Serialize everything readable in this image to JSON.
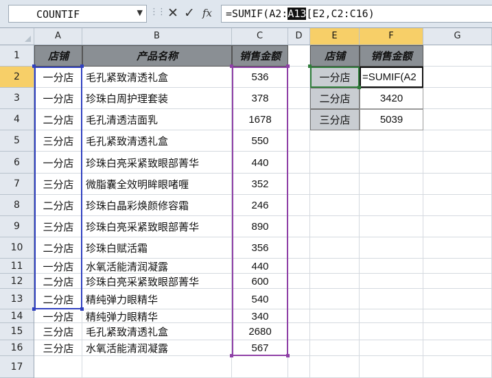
{
  "formula_bar": {
    "name_box": "COUNTIF",
    "formula_pre": "=SUMIF(A2:",
    "formula_hl": "A13",
    "formula_post": "[E2,C2:C16)",
    "fx_label": "fx"
  },
  "columns": [
    "A",
    "B",
    "C",
    "D",
    "E",
    "F",
    "G"
  ],
  "rows": [
    "1",
    "2",
    "3",
    "4",
    "5",
    "6",
    "7",
    "8",
    "9",
    "10",
    "11",
    "12",
    "13",
    "14",
    "15",
    "16",
    "17"
  ],
  "table": {
    "headers": [
      "店铺",
      "产品名称",
      "销售金额"
    ],
    "rows": [
      [
        "一分店",
        "毛孔紧致清透礼盒",
        "536"
      ],
      [
        "一分店",
        "珍珠白周护理套装",
        "378"
      ],
      [
        "二分店",
        "毛孔清透洁面乳",
        "1678"
      ],
      [
        "三分店",
        "毛孔紧致清透礼盒",
        "550"
      ],
      [
        "一分店",
        "珍珠白亮采紧致眼部菁华",
        "440"
      ],
      [
        "三分店",
        "微脂囊全效明眸眼啫喱",
        "352"
      ],
      [
        "二分店",
        "珍珠白晶彩焕颜修容霜",
        "246"
      ],
      [
        "三分店",
        "珍珠白亮采紧致眼部菁华",
        "890"
      ],
      [
        "二分店",
        "珍珠白赋活霜",
        "356"
      ],
      [
        "一分店",
        "水氧活能清润凝露",
        "440"
      ],
      [
        "二分店",
        "珍珠白亮采紧致眼部菁华",
        "600"
      ],
      [
        "二分店",
        "精纯弹力眼精华",
        "540"
      ],
      [
        "一分店",
        "精纯弹力眼精华",
        "340"
      ],
      [
        "三分店",
        "毛孔紧致清透礼盒",
        "2680"
      ],
      [
        "三分店",
        "水氧活能清润凝露",
        "567"
      ]
    ]
  },
  "summary": {
    "headers": [
      "店铺",
      "销售金额"
    ],
    "rows": [
      [
        "一分店",
        "=SUMIF(A2"
      ],
      [
        "二分店",
        "3420"
      ],
      [
        "三分店",
        "5039"
      ]
    ]
  }
}
